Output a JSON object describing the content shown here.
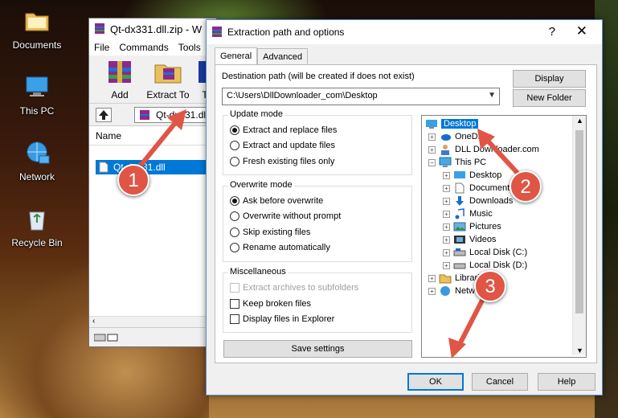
{
  "desktop": {
    "icons": [
      {
        "label": "Documents",
        "icon": "folder-icon"
      },
      {
        "label": "This PC",
        "icon": "computer-icon"
      },
      {
        "label": "Network",
        "icon": "network-icon"
      },
      {
        "label": "Recycle Bin",
        "icon": "recycle-bin-icon"
      }
    ]
  },
  "winrar": {
    "title": "Qt-dx331.dll.zip - W",
    "menu": [
      "File",
      "Commands",
      "Tools"
    ],
    "toolbar": [
      {
        "label": "Add",
        "icon": "add-archive-icon"
      },
      {
        "label": "Extract To",
        "icon": "extract-to-icon"
      },
      {
        "label": "T",
        "icon": "test-icon"
      }
    ],
    "path": "Qt-dx331.dll.",
    "column_name": "Name",
    "file": "Qt-dx331.dll"
  },
  "dialog": {
    "title": "Extraction path and options",
    "help": "?",
    "close": "✕",
    "tabs": [
      "General",
      "Advanced"
    ],
    "dest_label": "Destination path (will be created if does not exist)",
    "dest_value": "C:\\Users\\DllDownloader_com\\Desktop",
    "display_btn": "Display",
    "new_folder_btn": "New Folder",
    "update_mode": {
      "title": "Update mode",
      "options": [
        "Extract and replace files",
        "Extract and update files",
        "Fresh existing files only"
      ],
      "selected": 0
    },
    "overwrite_mode": {
      "title": "Overwrite mode",
      "options": [
        "Ask before overwrite",
        "Overwrite without prompt",
        "Skip existing files",
        "Rename automatically"
      ],
      "selected": 0
    },
    "misc": {
      "title": "Miscellaneous",
      "options": [
        "Extract archives to subfolders",
        "Keep broken files",
        "Display files in Explorer"
      ]
    },
    "save_settings": "Save settings",
    "tree": {
      "desktop": "Desktop",
      "onedrive": "OneDrive",
      "dlldownloader": "DLL Downloader.com",
      "thispc": "This PC",
      "children": [
        "Desktop",
        "Documents",
        "Downloads",
        "Music",
        "Pictures",
        "Videos",
        "Local Disk (C:)",
        "Local Disk (D:)"
      ],
      "libraries": "Libraries",
      "network": "Network"
    },
    "ok": "OK",
    "cancel": "Cancel",
    "help_btn": "Help"
  },
  "annotations": {
    "step1": "1",
    "step2": "2",
    "step3": "3",
    "color": "#e05545"
  }
}
